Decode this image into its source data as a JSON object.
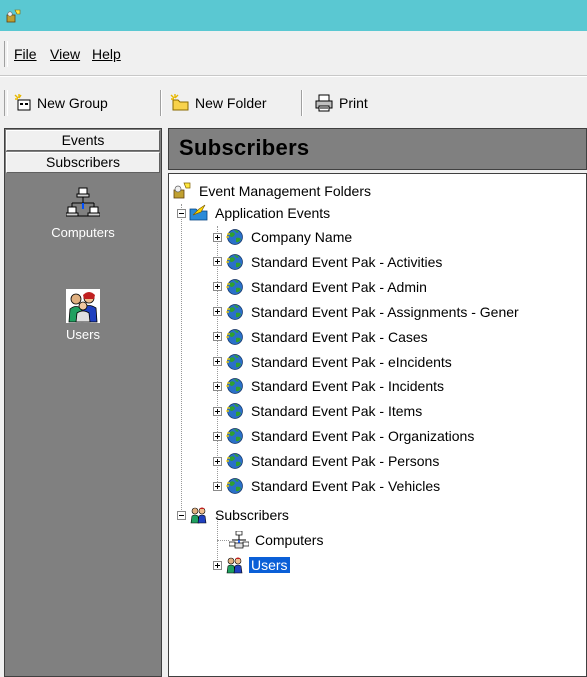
{
  "menu": {
    "file": "File",
    "view": "View",
    "help": "Help"
  },
  "toolbar": {
    "new_group": "New Group",
    "new_folder": "New Folder",
    "print": "Print"
  },
  "shortcut_bar": {
    "tab_events": "Events",
    "tab_subscribers": "Subscribers",
    "computers": "Computers",
    "users": "Users"
  },
  "caption": "Subscribers",
  "tree": {
    "root": "Event Management Folders",
    "application_events": "Application Events",
    "event_paks": [
      "Company Name",
      "Standard Event Pak - Activities",
      "Standard Event Pak - Admin",
      "Standard Event Pak - Assignments - Gener",
      "Standard Event Pak - Cases",
      "Standard Event Pak - eIncidents",
      "Standard Event Pak - Incidents",
      "Standard Event Pak - Items",
      "Standard Event Pak - Organizations",
      "Standard Event Pak - Persons",
      "Standard Event Pak - Vehicles"
    ],
    "subscribers": "Subscribers",
    "computers": "Computers",
    "users": "Users"
  },
  "colors": {
    "titlebar": "#5ac8d2",
    "selection": "#0a5fd7",
    "pane_gray": "#808080"
  }
}
